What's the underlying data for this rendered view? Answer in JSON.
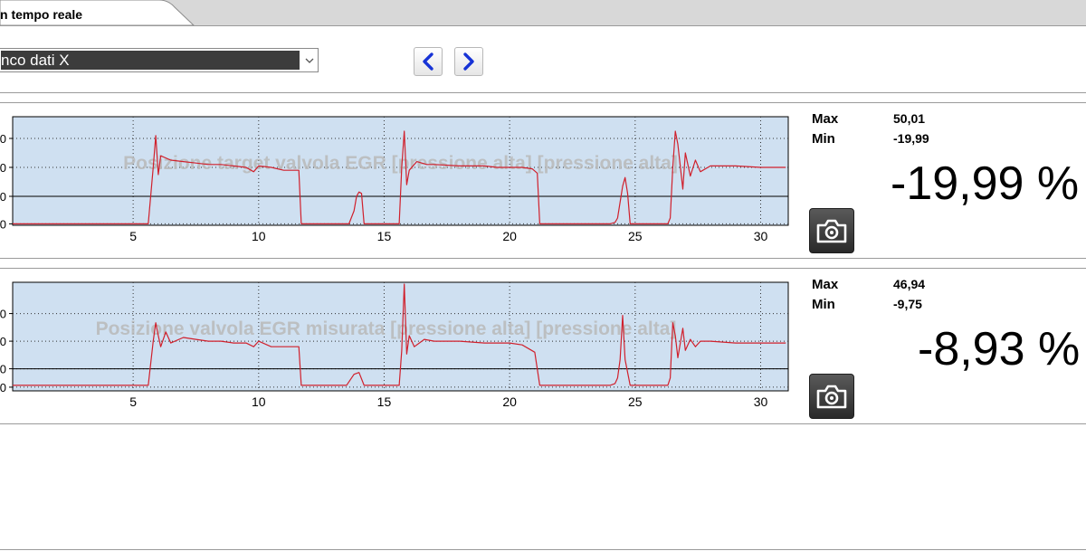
{
  "tab": {
    "label": "n tempo reale"
  },
  "selector": {
    "value": "nco dati X"
  },
  "charts": [
    {
      "title": "Posizione target valvola EGR [pressione alta] [pressione alta]",
      "max_label": "Max",
      "min_label": "Min",
      "max_value": "50,01",
      "min_value": "-19,99",
      "current_value": "-19,99 %",
      "x_ticks": [
        "5",
        "10",
        "15",
        "20",
        "25",
        "30"
      ],
      "y_ticks": [
        "0",
        "0",
        "0",
        "0"
      ],
      "chart_data": {
        "type": "line",
        "x": [
          0.2,
          5.6,
          5.8,
          5.9,
          6.0,
          6.1,
          6.5,
          7,
          7.5,
          8,
          8.5,
          9,
          9.5,
          9.8,
          10,
          10.5,
          11,
          11.5,
          11.6,
          11.7,
          12,
          13,
          13.3,
          13.6,
          13.8,
          13.9,
          14.0,
          14.1,
          14.2,
          14.3,
          15,
          15.6,
          15.7,
          15.8,
          15.9,
          16.0,
          16.3,
          16.7,
          17,
          18,
          19,
          19.5,
          20,
          20.5,
          20.9,
          21.1,
          21.2,
          22,
          23,
          24,
          24.2,
          24.3,
          24.5,
          24.6,
          24.7,
          24.8,
          25,
          26,
          26.3,
          26.4,
          26.5,
          26.6,
          26.7,
          26.9,
          27.0,
          27.2,
          27.4,
          27.6,
          28,
          29,
          30,
          31
        ],
        "y": [
          -19,
          -19,
          20,
          42,
          15,
          28,
          25,
          24,
          23,
          22,
          22,
          21,
          20,
          17,
          21,
          20,
          18,
          18,
          18,
          -19,
          -19,
          -19,
          -19,
          -19,
          -10,
          0,
          3,
          2,
          -19,
          -19,
          -19,
          -19,
          20,
          45,
          8,
          18,
          24,
          22,
          22,
          21,
          21,
          20,
          20,
          20,
          19,
          16,
          -19,
          -19,
          -19,
          -19,
          -18,
          -15,
          7,
          13,
          2,
          -19,
          -19,
          -19,
          -19,
          -15,
          20,
          45,
          36,
          5,
          30,
          14,
          25,
          17,
          21,
          21,
          20,
          20
        ]
      }
    },
    {
      "title": "Posizione valvola EGR misurata [pressione alta] [pressione alta]",
      "max_label": "Max",
      "min_label": "Min",
      "max_value": "46,94",
      "min_value": "-9,75",
      "current_value": "-8,93 %",
      "x_ticks": [
        "5",
        "10",
        "15",
        "20",
        "25",
        "30"
      ],
      "y_ticks": [
        "0",
        "0",
        "0",
        "0"
      ],
      "chart_data": {
        "type": "line",
        "x": [
          0.2,
          5.6,
          5.8,
          5.9,
          6.0,
          6.1,
          6.3,
          6.5,
          7,
          7.5,
          8,
          8.5,
          9,
          9.5,
          9.8,
          10,
          10.5,
          11,
          11.6,
          11.7,
          12,
          13,
          13.5,
          13.8,
          14.0,
          14.2,
          14.3,
          15,
          15.6,
          15.7,
          15.8,
          15.9,
          16.0,
          16.2,
          16.6,
          17,
          18,
          19,
          19.5,
          20,
          20.5,
          21.0,
          21.2,
          21.3,
          22,
          23,
          24,
          24.2,
          24.3,
          24.4,
          24.5,
          24.6,
          24.8,
          25,
          26,
          26.3,
          26.4,
          26.5,
          26.6,
          26.7,
          26.9,
          27.0,
          27.2,
          27.4,
          27.6,
          28,
          29,
          30,
          31
        ],
        "y": [
          -9,
          -9,
          15,
          25,
          18,
          12,
          20,
          14,
          17,
          16,
          15,
          15,
          14,
          14,
          12,
          15,
          12,
          12,
          12,
          -9,
          -9,
          -9,
          -9,
          -3,
          -2,
          -9,
          -9,
          -9,
          -9,
          10,
          46,
          8,
          18,
          12,
          16,
          15,
          15,
          14,
          14,
          14,
          13,
          9,
          -9,
          -9,
          -9,
          -9,
          -9,
          -8,
          -5,
          5,
          29,
          5,
          -9,
          -9,
          -9,
          -9,
          -5,
          25,
          18,
          6,
          22,
          10,
          16,
          12,
          15,
          15,
          14,
          14,
          14
        ]
      }
    }
  ]
}
